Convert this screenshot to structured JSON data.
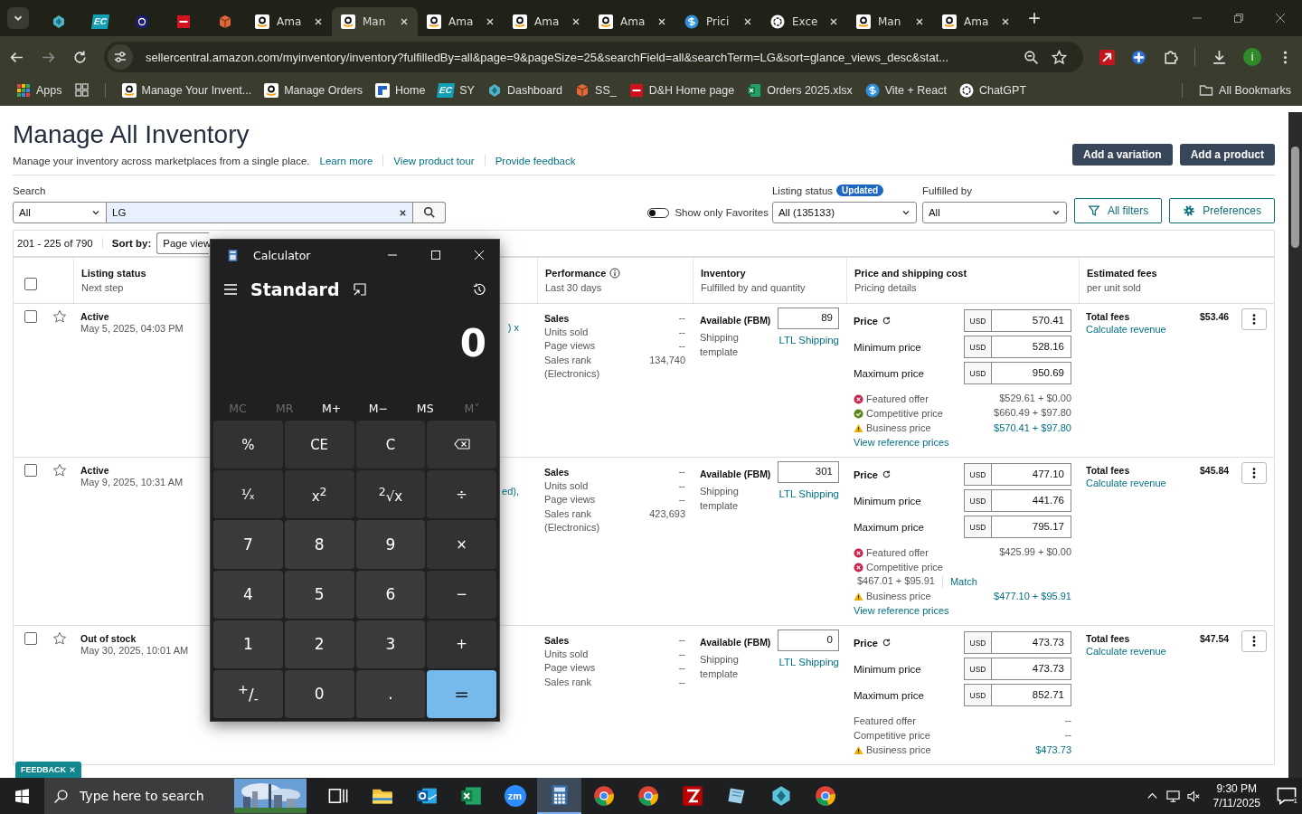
{
  "browser": {
    "tabs": [
      {
        "kind": "diamond",
        "selected": false
      },
      {
        "kind": "ec",
        "logo": "EC",
        "selected": false
      },
      {
        "kind": "bu",
        "selected": false
      },
      {
        "kind": "dh",
        "selected": false
      },
      {
        "kind": "ss",
        "selected": false
      },
      {
        "kind": "amazon",
        "title": "Ama",
        "selected": false
      },
      {
        "kind": "amazon",
        "title": "Man",
        "selected": true
      },
      {
        "kind": "amazon",
        "title": "Ama",
        "selected": false
      },
      {
        "kind": "amazon",
        "title": "Ama",
        "selected": false
      },
      {
        "kind": "amazon",
        "title": "Ama",
        "selected": false
      },
      {
        "kind": "dollar",
        "title": "Prici",
        "selected": false
      },
      {
        "kind": "openai",
        "title": "Exce",
        "selected": false
      },
      {
        "kind": "amazon",
        "title": "Man",
        "selected": false
      },
      {
        "kind": "amazon",
        "title": "Ama",
        "selected": false
      }
    ],
    "url": "sellercentral.amazon.com/myinventory/inventory?fulfilledBy=all&page=9&pageSize=25&searchField=all&searchTerm=LG&sort=glance_views_desc&stat...",
    "profile": "i",
    "bookmarks": [
      {
        "kind": "apps",
        "label": "Apps"
      },
      {
        "kind": "amazon",
        "label": "Manage Your Invent..."
      },
      {
        "kind": "amazon",
        "label": "Manage Orders"
      },
      {
        "kind": "g",
        "label": "Home"
      },
      {
        "kind": "ec",
        "logo": "EC",
        "label": "SY"
      },
      {
        "kind": "diamond",
        "label": "Dashboard"
      },
      {
        "kind": "ss",
        "label": "SS_"
      },
      {
        "kind": "dh",
        "label": "D&H Home page"
      },
      {
        "kind": "excel",
        "label": "Orders 2025.xlsx"
      },
      {
        "kind": "dollar",
        "label": "Vite + React"
      },
      {
        "kind": "openai",
        "label": "ChatGPT"
      }
    ],
    "all_bookmarks": "All Bookmarks"
  },
  "page": {
    "title": "Manage All Inventory",
    "subtitle": "Manage your inventory across marketplaces from a single place.",
    "links": [
      "Learn more",
      "View product tour",
      "Provide feedback"
    ],
    "buttons": [
      "Add a variation",
      "Add a product"
    ],
    "search": {
      "label": "Search",
      "scope": "All",
      "value": "LG"
    },
    "favorites": {
      "label": "Show only Favorites",
      "on": false
    },
    "listing_status": {
      "label": "Listing status",
      "badge": "Updated",
      "value": "All (135133)"
    },
    "fulfilled_by": {
      "label": "Fulfilled by",
      "value": "All"
    },
    "filter_buttons": [
      {
        "kind": "filter",
        "label": "All filters"
      },
      {
        "kind": "gear",
        "label": "Preferences"
      }
    ],
    "results": "201 - 225 of 790",
    "sort_label": "Sort by:",
    "sort_value": "Page view",
    "select_all_checked": false,
    "columns": [
      {
        "title": "Listing status",
        "subtitle": "Next step",
        "info": false
      },
      {
        "title": "Performance",
        "subtitle": "Last 30 days",
        "info": true
      },
      {
        "title": "Inventory",
        "subtitle": "Fulfilled by and quantity",
        "info": false
      },
      {
        "title": "Price and shipping cost",
        "subtitle": "Pricing details",
        "info": false
      },
      {
        "title": "Estimated fees",
        "subtitle": "per unit sold",
        "info": false
      }
    ],
    "rows": [
      {
        "checked": false,
        "favorite": false,
        "status": "Active",
        "date": "May 5, 2025, 04:03 PM",
        "product_fragment": ") x",
        "performance": [
          {
            "kind": "head",
            "label": "Sales",
            "value": "--"
          },
          {
            "kind": "metric",
            "label": "Units sold",
            "value": "--"
          },
          {
            "kind": "metric",
            "label": "Page views",
            "value": "--"
          },
          {
            "kind": "metric",
            "label": "Sales rank",
            "value": "134,740"
          }
        ],
        "rank_category": "(Electronics)",
        "inventory": {
          "label": "Available (FBM)",
          "quantity": "89",
          "shipping_label": "Shipping template",
          "shipping": "LTL Shipping"
        },
        "prices": [
          {
            "kind": "current",
            "label": "Price",
            "currency": "USD",
            "value": "570.41"
          },
          {
            "kind": "limit",
            "label": "Minimum price",
            "currency": "USD",
            "value": "528.16"
          },
          {
            "kind": "limit",
            "label": "Maximum price",
            "currency": "USD",
            "value": "950.69"
          }
        ],
        "reference": [
          {
            "kind": "error",
            "label": "Featured offer",
            "value": "$529.61 + $0.00",
            "link": false
          },
          {
            "kind": "ok",
            "label": "Competitive price",
            "value": "$660.49 + $97.80",
            "link": false
          },
          {
            "kind": "warn",
            "label": "Business price",
            "value": "$570.41 + $97.80",
            "link": true
          }
        ],
        "reference_link": "View reference prices",
        "fees_label": "Total fees",
        "fees_link": "Calculate revenue",
        "fees": "$53.46"
      },
      {
        "checked": false,
        "favorite": false,
        "status": "Active",
        "date": "May 9, 2025, 10:31 AM",
        "product_fragment": "ed),",
        "performance": [
          {
            "kind": "head",
            "label": "Sales",
            "value": "--"
          },
          {
            "kind": "metric",
            "label": "Units sold",
            "value": "--"
          },
          {
            "kind": "metric",
            "label": "Page views",
            "value": "--"
          },
          {
            "kind": "metric",
            "label": "Sales rank",
            "value": "423,693"
          }
        ],
        "rank_category": "(Electronics)",
        "inventory": {
          "label": "Available (FBM)",
          "quantity": "301",
          "shipping_label": "Shipping template",
          "shipping": "LTL Shipping"
        },
        "prices": [
          {
            "kind": "current",
            "label": "Price",
            "currency": "USD",
            "value": "477.10"
          },
          {
            "kind": "limit",
            "label": "Minimum price",
            "currency": "USD",
            "value": "441.76"
          },
          {
            "kind": "limit",
            "label": "Maximum price",
            "currency": "USD",
            "value": "795.17"
          }
        ],
        "reference": [
          {
            "kind": "error",
            "label": "Featured offer",
            "value": "$425.99 + $0.00",
            "link": false
          },
          {
            "kind": "error",
            "label": "Competitive price",
            "value": "$467.01 + $95.91",
            "action": "Match",
            "link": false
          },
          {
            "kind": "warn",
            "label": "Business price",
            "value": "$477.10 + $95.91",
            "link": true
          }
        ],
        "reference_link": "View reference prices",
        "fees_label": "Total fees",
        "fees_link": "Calculate revenue",
        "fees": "$45.84"
      },
      {
        "checked": false,
        "favorite": false,
        "status": "Out of stock",
        "date": "May 30, 2025, 10:01 AM",
        "performance": [
          {
            "kind": "head",
            "label": "Sales",
            "value": "--"
          },
          {
            "kind": "metric",
            "label": "Units sold",
            "value": "--"
          },
          {
            "kind": "metric",
            "label": "Page views",
            "value": "--"
          },
          {
            "kind": "metric",
            "label": "Sales rank",
            "value": "--"
          }
        ],
        "inventory": {
          "label": "Available (FBM)",
          "quantity": "0",
          "shipping_label": "Shipping template",
          "shipping": "LTL Shipping"
        },
        "prices": [
          {
            "kind": "current",
            "label": "Price",
            "currency": "USD",
            "value": "473.73"
          },
          {
            "kind": "limit",
            "label": "Minimum price",
            "currency": "USD",
            "value": "473.73"
          },
          {
            "kind": "limit",
            "label": "Maximum price",
            "currency": "USD",
            "value": "852.71"
          }
        ],
        "reference": [
          {
            "kind": "none",
            "label": "Featured offer",
            "value": "--",
            "link": false
          },
          {
            "kind": "none",
            "label": "Competitive price",
            "value": "--",
            "link": false
          },
          {
            "kind": "warn",
            "label": "Business price",
            "value": "$473.73",
            "link": true
          }
        ],
        "fees_label": "Total fees",
        "fees_link": "Calculate revenue",
        "fees": "$47.54"
      }
    ],
    "feedback": "FEEDBACK"
  },
  "calculator": {
    "title": "Calculator",
    "mode": "Standard",
    "display": "0",
    "memory": [
      {
        "label": "MC",
        "disabled": true
      },
      {
        "label": "MR",
        "disabled": true
      },
      {
        "label": "M+",
        "disabled": false
      },
      {
        "label": "M−",
        "disabled": false
      },
      {
        "label": "MS",
        "disabled": false
      },
      {
        "label": "M˅",
        "disabled": true
      }
    ],
    "keys": [
      {
        "kind": "func",
        "label": "%"
      },
      {
        "kind": "func",
        "label": "CE"
      },
      {
        "kind": "func",
        "label": "C"
      },
      {
        "kind": "backspace"
      },
      {
        "kind": "func",
        "label": "¹⁄ₓ"
      },
      {
        "kind": "func",
        "label": "x$^{2}$"
      },
      {
        "kind": "func",
        "label": "$^{2}$√x"
      },
      {
        "kind": "func",
        "label": "÷"
      },
      {
        "kind": "digit",
        "label": "7"
      },
      {
        "kind": "digit",
        "label": "8"
      },
      {
        "kind": "digit",
        "label": "9"
      },
      {
        "kind": "func",
        "label": "×"
      },
      {
        "kind": "digit",
        "label": "4"
      },
      {
        "kind": "digit",
        "label": "5"
      },
      {
        "kind": "digit",
        "label": "6"
      },
      {
        "kind": "func",
        "label": "−"
      },
      {
        "kind": "digit",
        "label": "1"
      },
      {
        "kind": "digit",
        "label": "2"
      },
      {
        "kind": "digit",
        "label": "3"
      },
      {
        "kind": "func",
        "label": "+"
      },
      {
        "kind": "digit",
        "label": "$^{+}$/$_{-}$"
      },
      {
        "kind": "digit",
        "label": "0"
      },
      {
        "kind": "digit",
        "label": "."
      },
      {
        "kind": "equals",
        "label": "="
      }
    ]
  },
  "taskbar": {
    "search_placeholder": "Type here to search",
    "apps": [
      {
        "kind": "taskview",
        "selected": false
      },
      {
        "kind": "folder",
        "selected": false
      },
      {
        "kind": "mail",
        "selected": false
      },
      {
        "kind": "excel",
        "selected": false
      },
      {
        "kind": "zoom",
        "logo": "zm",
        "selected": false
      },
      {
        "kind": "calculator",
        "selected": true
      },
      {
        "kind": "chrome",
        "selected": false
      },
      {
        "kind": "chrome",
        "selected": false
      },
      {
        "kind": "filezilla",
        "selected": false
      },
      {
        "kind": "notes",
        "selected": false
      },
      {
        "kind": "diamond",
        "selected": false
      },
      {
        "kind": "chrome",
        "selected": false
      }
    ],
    "time": "9:30 PM",
    "date": "7/11/2025",
    "notifications": "1"
  }
}
